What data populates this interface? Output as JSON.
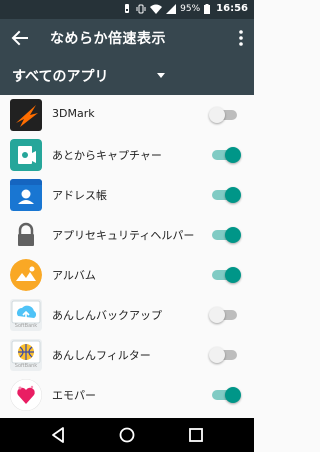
{
  "status_bar": {
    "battery": "95%",
    "time": "16:56"
  },
  "app_bar": {
    "title": "なめらか倍速表示"
  },
  "filter": {
    "label": "すべてのアプリ"
  },
  "apps": [
    {
      "name": "3DMark",
      "enabled": false,
      "icon": "3dmark-icon",
      "color": "#e65100"
    },
    {
      "name": "あとからキャプチャー",
      "enabled": true,
      "icon": "capture-icon",
      "color": "#26a69a"
    },
    {
      "name": "アドレス帳",
      "enabled": true,
      "icon": "contacts-icon",
      "color": "#1976d2"
    },
    {
      "name": "アプリセキュリティヘルパー",
      "enabled": true,
      "icon": "lock-icon",
      "color": "#616161"
    },
    {
      "name": "アルバム",
      "enabled": true,
      "icon": "album-icon",
      "color": "#f9a825"
    },
    {
      "name": "あんしんバックアップ",
      "enabled": false,
      "icon": "backup-icon",
      "color": "#4fc3f7",
      "caption": "SoftBank"
    },
    {
      "name": "あんしんフィルター",
      "enabled": false,
      "icon": "filter-icon",
      "color": "#5c6bc0",
      "caption": "SoftBank"
    },
    {
      "name": "エモパー",
      "enabled": true,
      "icon": "emopa-icon",
      "color": "#e91e63"
    }
  ],
  "colors": {
    "toolbar": "#37474f",
    "status_bar": "#263238",
    "switch_on": "#009688",
    "switch_off": "#f1f1f1"
  }
}
